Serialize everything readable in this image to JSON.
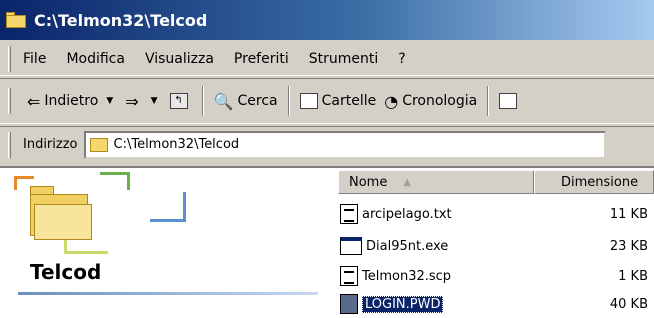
{
  "window": {
    "title": "C:\\Telmon32\\Telcod",
    "title_icon": "folder-open-icon"
  },
  "menu": {
    "items": [
      "File",
      "Modifica",
      "Visualizza",
      "Preferiti",
      "Strumenti",
      "?"
    ]
  },
  "toolbar": {
    "back_label": "Indietro",
    "back_icon": "back-arrow-icon",
    "forward_icon": "forward-arrow-icon",
    "up_icon": "up-folder-icon",
    "search_label": "Cerca",
    "folders_label": "Cartelle",
    "history_label": "Cronologia"
  },
  "address": {
    "label": "Indirizzo",
    "value": "C:\\Telmon32\\Telcod"
  },
  "folder_panel": {
    "caption": "Telcod"
  },
  "file_list": {
    "columns": [
      "Nome",
      "Dimensione"
    ],
    "sort_column": "Nome",
    "rows": [
      {
        "name": "arcipelago.txt",
        "size": "11 KB",
        "icon": "text-file-icon",
        "selected": false
      },
      {
        "name": "Dial95nt.exe",
        "size": "23 KB",
        "icon": "exe-file-icon",
        "selected": false
      },
      {
        "name": "Telmon32.scp",
        "size": "1 KB",
        "icon": "text-file-icon",
        "selected": false
      },
      {
        "name": "LOGIN.PWD",
        "size": "40 KB",
        "icon": "pwd-file-icon",
        "selected": true
      }
    ]
  },
  "colors": {
    "title_gradient_start": "#0a246a",
    "title_gradient_end": "#a6caf0",
    "selection": "#0a246a",
    "chrome": "#d4d0c8"
  }
}
